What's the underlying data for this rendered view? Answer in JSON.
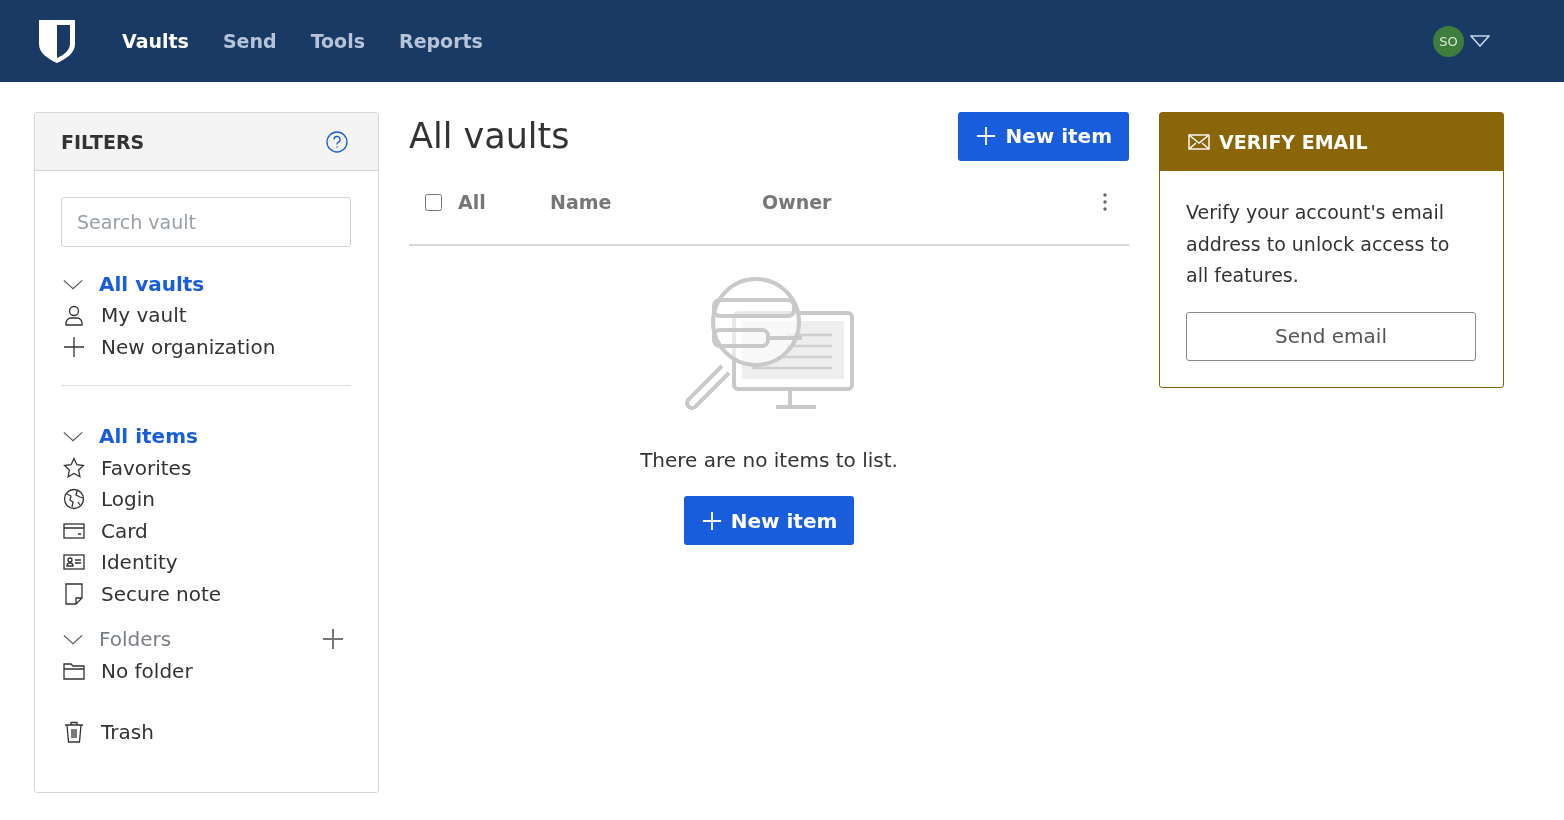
{
  "nav": {
    "links": [
      {
        "label": "Vaults",
        "selected": true
      },
      {
        "label": "Send",
        "selected": false
      },
      {
        "label": "Tools",
        "selected": false
      },
      {
        "label": "Reports",
        "selected": false
      }
    ],
    "avatar": "SO"
  },
  "filters": {
    "title": "FILTERS",
    "search": {
      "placeholder": "Search vault"
    },
    "sections": [
      {
        "header": {
          "label": "All vaults",
          "selected": true,
          "expanded": true
        },
        "items": [
          "My vault",
          "New organization"
        ]
      },
      {
        "header": {
          "label": "All items",
          "selected": true,
          "expanded": true
        },
        "items": [
          "Favorites",
          "Login",
          "Card",
          "Identity",
          "Secure note"
        ]
      },
      {
        "header": {
          "label": "Folders",
          "selected": false,
          "expanded": true
        },
        "items": [
          "No folder"
        ]
      }
    ],
    "trash": "Trash"
  },
  "main": {
    "title": "All vaults",
    "new_item": "New item",
    "table": {
      "columns": [
        "All",
        "Name",
        "Owner"
      ],
      "all_checked": false
    },
    "empty": {
      "message": "There are no items to list.",
      "button": "New item"
    }
  },
  "verify": {
    "title": "VERIFY EMAIL",
    "text": "Verify your account's email address to unlock access to all features.",
    "button": "Send email"
  }
}
